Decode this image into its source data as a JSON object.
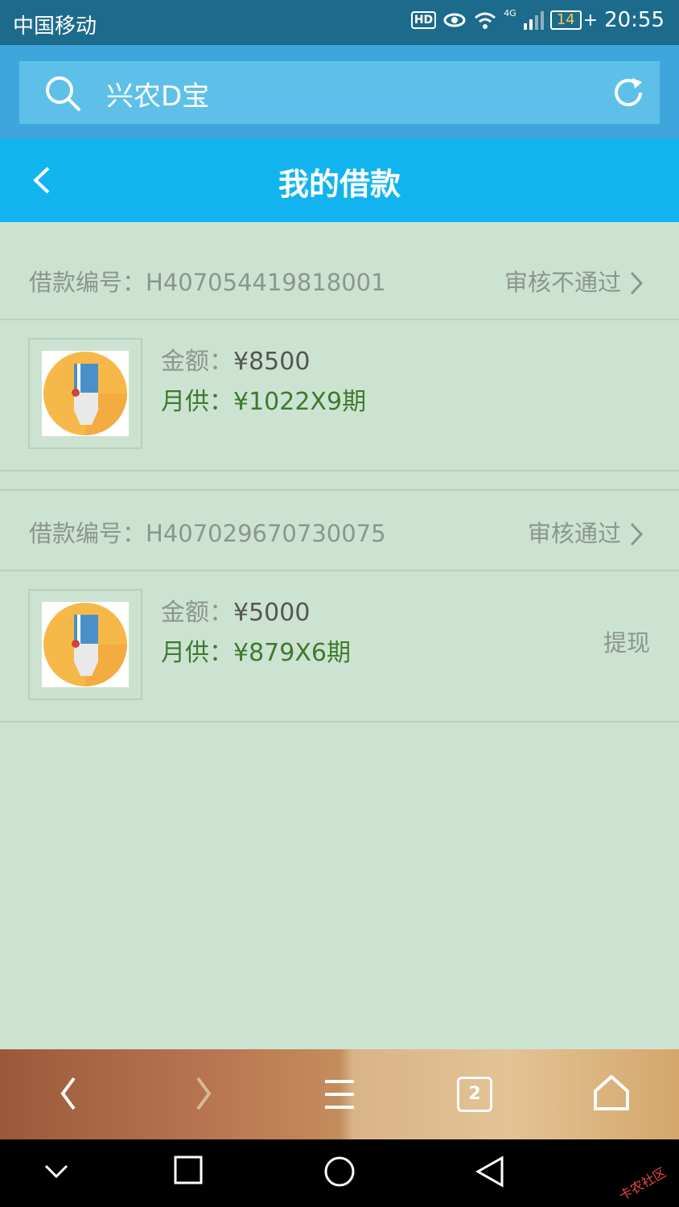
{
  "status_bar": {
    "carrier": "中国移动",
    "hd": "HD",
    "network": "4G",
    "battery": "14",
    "time": "20:55"
  },
  "browser": {
    "search_text": "兴农D宝"
  },
  "header": {
    "title": "我的借款"
  },
  "loans": [
    {
      "id_label": "借款编号：",
      "id": "H407054419818001",
      "status": "审核不通过",
      "amount_label": "金额：",
      "amount": "¥8500",
      "monthly_label": "月供：",
      "monthly": "¥1022X9期",
      "action": ""
    },
    {
      "id_label": "借款编号：",
      "id": "H407029670730075",
      "status": "审核通过",
      "amount_label": "金额：",
      "amount": "¥5000",
      "monthly_label": "月供：",
      "monthly": "¥879X6期",
      "action": "提现"
    }
  ],
  "browser_nav": {
    "tabs_count": "2"
  },
  "watermark": "卡农社区"
}
